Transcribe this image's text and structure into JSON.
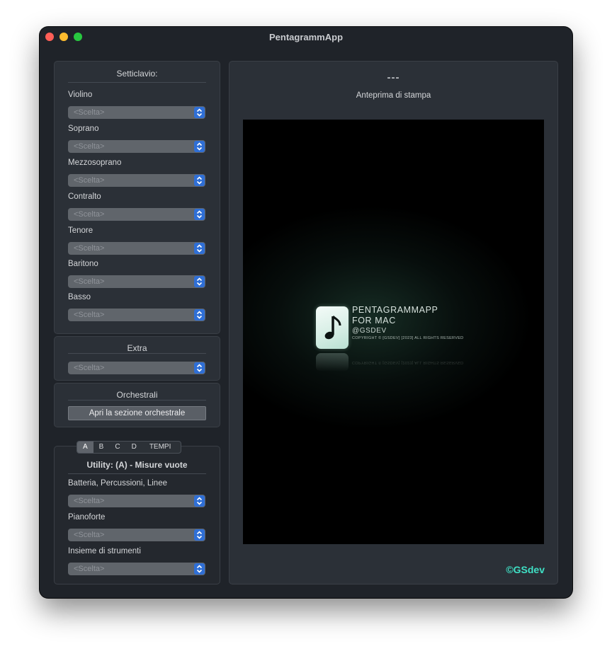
{
  "window": {
    "title": "PentagrammApp"
  },
  "setticlavio": {
    "title": "Setticlavio:",
    "fields": [
      {
        "label": "Violino",
        "value": "<Scelta>"
      },
      {
        "label": "Soprano",
        "value": "<Scelta>"
      },
      {
        "label": "Mezzosoprano",
        "value": "<Scelta>"
      },
      {
        "label": "Contralto",
        "value": "<Scelta>"
      },
      {
        "label": "Tenore",
        "value": "<Scelta>"
      },
      {
        "label": "Baritono",
        "value": "<Scelta>"
      },
      {
        "label": "Basso",
        "value": "<Scelta>"
      }
    ]
  },
  "extra": {
    "title": "Extra",
    "value": "<Scelta>"
  },
  "orchestrali": {
    "title": "Orchestrali",
    "button": "Apri la sezione orchestrale"
  },
  "utility": {
    "tabs": [
      "A",
      "B",
      "C",
      "D",
      "TEMPI"
    ],
    "active_tab": "A",
    "title": "Utility: (A) - Misure vuote",
    "fields": [
      {
        "label": "Batteria, Percussioni, Linee",
        "value": "<Scelta>"
      },
      {
        "label": "Pianoforte",
        "value": "<Scelta>"
      },
      {
        "label": "Insieme di strumenti",
        "value": "<Scelta>"
      }
    ]
  },
  "preview": {
    "placeholder": "---",
    "label": "Anteprima di stampa",
    "splash": {
      "line1": "PENTAGRAMMAPP",
      "line2": "FOR MAC",
      "line3": "@GSDEV",
      "copyright": "COPYRIGHT © [GSDEV] [2023] ALL RIGHTS RESERVED"
    },
    "brand": "©GSdev"
  },
  "colors": {
    "accent": "#2f6fd6",
    "brand": "#3fe0c5"
  },
  "icons": {
    "stepper": "chevron-up-down-icon",
    "app": "music-note-icon"
  }
}
